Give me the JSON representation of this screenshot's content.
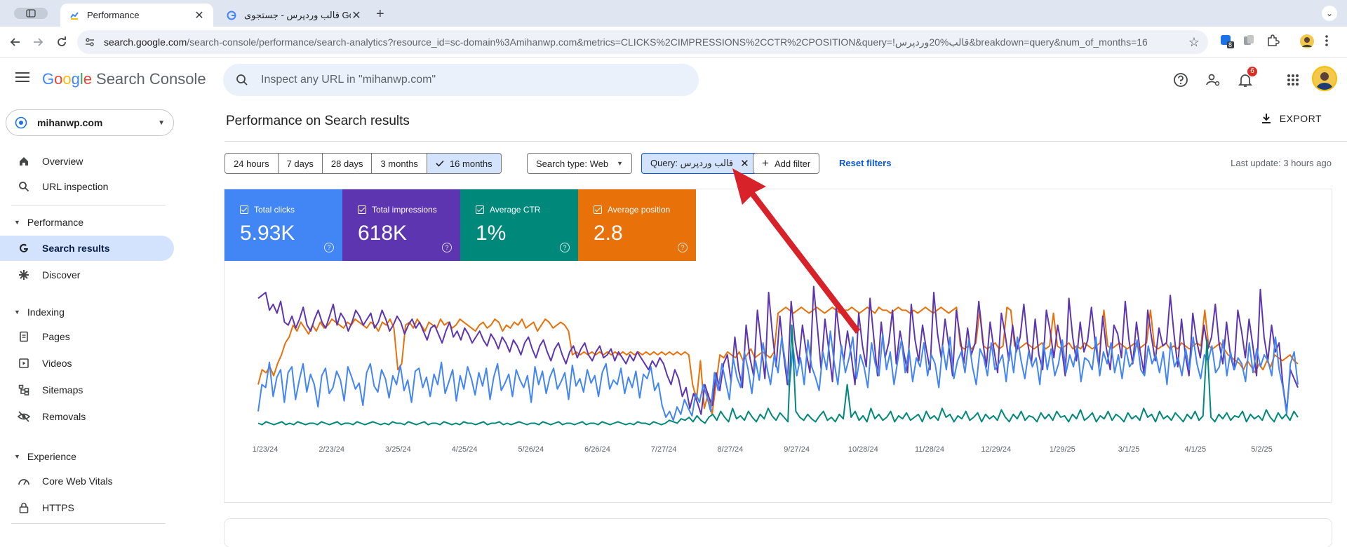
{
  "browser": {
    "tabs": [
      {
        "title": "Performance"
      },
      {
        "title": "قالب وردپرس - جستجوی Google"
      }
    ],
    "url_main": "search.google.com",
    "url_rest": "/search-console/performance/search-analytics?resource_id=sc-domain%3Amihanwp.com&metrics=CLICKS%2CIMPRESSIONS%2CCTR%2CPOSITION&query=!قالب%20وردپرس&breakdown=query&num_of_months=16",
    "ext_badge": "8"
  },
  "header": {
    "logo_letters": [
      "G",
      "o",
      "o",
      "g",
      "l",
      "e"
    ],
    "product": "Search Console",
    "search_placeholder": "Inspect any URL in \"mihanwp.com\"",
    "notifications_count": "6"
  },
  "sidebar": {
    "property": "mihanwp.com",
    "items": [
      {
        "label": "Overview",
        "icon": "home-icon"
      },
      {
        "label": "URL inspection",
        "icon": "search-icon"
      }
    ],
    "performance": {
      "section": "Performance",
      "items": [
        {
          "label": "Search results",
          "icon": "google-g-icon"
        },
        {
          "label": "Discover",
          "icon": "asterisk-icon"
        }
      ]
    },
    "indexing": {
      "section": "Indexing",
      "items": [
        {
          "label": "Pages",
          "icon": "pages-icon"
        },
        {
          "label": "Videos",
          "icon": "videos-icon"
        },
        {
          "label": "Sitemaps",
          "icon": "sitemaps-icon"
        },
        {
          "label": "Removals",
          "icon": "removals-icon"
        }
      ]
    },
    "experience": {
      "section": "Experience",
      "items": [
        {
          "label": "Core Web Vitals",
          "icon": "core-web-vitals-icon"
        },
        {
          "label": "HTTPS",
          "icon": "lock-icon"
        }
      ]
    }
  },
  "main": {
    "title": "Performance on Search results",
    "export_label": "EXPORT",
    "date_ranges": [
      "24 hours",
      "7 days",
      "28 days",
      "3 months",
      "16 months"
    ],
    "selected_range": "16 months",
    "search_type": "Search type: Web",
    "query_filter": "Query: قالب وردپرس",
    "add_filter": "Add filter",
    "reset_filters": "Reset filters",
    "last_update": "Last update: 3 hours ago"
  },
  "metrics": [
    {
      "label": "Total clicks",
      "value": "5.93K",
      "color": "#4285f4"
    },
    {
      "label": "Total impressions",
      "value": "618K",
      "color": "#5e35b1"
    },
    {
      "label": "Average CTR",
      "value": "1%",
      "color": "#00897b"
    },
    {
      "label": "Average position",
      "value": "2.8",
      "color": "#e8710a"
    }
  ],
  "chart_data": {
    "type": "line",
    "x_tick_labels": [
      "1/23/24",
      "2/23/24",
      "3/25/24",
      "4/25/24",
      "5/26/24",
      "6/26/24",
      "7/27/24",
      "8/27/24",
      "9/27/24",
      "10/28/24",
      "11/28/24",
      "12/29/24",
      "1/29/25",
      "3/1/25",
      "4/1/25",
      "5/2/25"
    ],
    "grid": false,
    "series": [
      {
        "name": "Total clicks",
        "color": "#4285f4",
        "values": [
          12,
          30,
          28,
          45,
          22,
          35,
          40,
          18,
          38,
          42,
          20,
          33,
          44,
          25,
          37,
          30,
          15,
          36,
          41,
          24,
          28,
          39,
          33,
          19,
          42,
          35,
          27,
          31,
          16,
          38,
          44,
          29,
          25,
          40,
          34,
          21,
          36,
          30,
          43,
          26,
          33,
          18,
          39,
          41,
          28,
          35,
          22,
          37,
          30,
          45,
          24,
          32,
          40,
          19,
          36,
          27,
          42,
          34,
          23,
          38,
          29,
          41,
          20,
          35,
          44,
          26,
          31,
          37,
          22,
          40,
          33,
          28,
          36,
          18,
          42,
          30,
          39,
          24,
          35,
          41,
          27,
          32,
          38,
          20,
          43,
          29,
          34,
          25,
          40,
          31,
          36,
          22,
          38,
          44,
          27,
          33,
          30,
          41,
          24,
          35,
          28,
          39,
          21,
          37,
          34,
          42,
          26,
          31,
          16,
          8,
          12,
          6,
          15,
          10,
          20,
          14,
          9,
          24,
          18,
          30,
          22,
          12,
          38,
          26,
          44,
          32,
          20,
          48,
          35,
          28,
          52,
          40,
          24,
          46,
          33,
          58,
          42,
          30,
          50,
          38,
          62,
          44,
          28,
          55,
          36,
          48,
          30,
          60,
          42,
          35,
          26,
          52,
          40,
          66,
          45,
          30,
          56,
          38,
          48,
          62,
          34,
          50,
          42,
          28,
          58,
          44,
          36,
          64,
          40,
          52,
          30,
          46,
          60,
          38,
          54,
          32,
          48,
          42,
          58,
          36,
          50,
          44,
          28,
          56,
          40,
          62,
          34,
          46,
          52,
          38,
          60,
          42,
          30,
          54,
          48,
          36,
          58,
          40,
          44,
          50,
          32,
          56,
          38,
          62,
          46,
          34,
          52,
          42,
          48,
          30,
          58,
          40,
          54,
          36,
          44,
          60,
          38,
          50,
          42,
          56,
          32,
          48,
          46,
          40,
          62,
          36,
          52,
          44,
          58,
          38,
          50,
          34,
          54,
          42,
          46,
          60,
          40,
          36,
          56,
          44,
          50,
          38,
          52,
          30,
          58,
          42,
          48,
          36,
          54,
          40,
          62,
          44,
          34,
          50,
          46,
          56,
          38,
          42,
          60,
          36,
          52,
          40,
          48,
          44,
          32,
          58,
          38,
          54,
          42,
          50,
          46,
          36,
          62,
          40,
          28,
          10,
          44,
          52,
          30
        ]
      },
      {
        "name": "Total impressions",
        "color": "#5e35b1",
        "values": [
          88,
          90,
          92,
          80,
          84,
          78,
          86,
          72,
          70,
          76,
          68,
          74,
          82,
          70,
          66,
          74,
          80,
          72,
          68,
          76,
          84,
          70,
          78,
          74,
          66,
          72,
          80,
          76,
          70,
          74,
          78,
          68,
          72,
          80,
          74,
          66,
          70,
          76,
          72,
          64,
          70,
          74,
          68,
          72,
          66,
          60,
          68,
          70,
          64,
          58,
          66,
          72,
          62,
          66,
          60,
          68,
          64,
          58,
          62,
          66,
          60,
          56,
          64,
          60,
          54,
          62,
          58,
          52,
          60,
          56,
          50,
          58,
          62,
          54,
          48,
          56,
          60,
          52,
          46,
          54,
          58,
          50,
          44,
          52,
          56,
          48,
          54,
          58,
          50,
          46,
          52,
          56,
          48,
          50,
          54,
          46,
          52,
          48,
          44,
          50,
          46,
          52,
          48,
          44,
          40,
          46,
          42,
          48,
          44,
          36,
          30,
          40,
          34,
          22,
          28,
          14,
          24,
          18,
          10,
          30,
          22,
          16,
          38,
          26,
          44,
          50,
          32,
          62,
          40,
          28,
          70,
          48,
          36,
          80,
          58,
          34,
          92,
          64,
          42,
          76,
          50,
          30,
          86,
          60,
          44,
          70,
          52,
          38,
          96,
          68,
          40,
          74,
          54,
          32,
          82,
          60,
          46,
          66,
          50,
          30,
          78,
          56,
          42,
          88,
          62,
          36,
          72,
          48,
          58,
          80,
          44,
          66,
          52,
          38,
          84,
          60,
          46,
          70,
          54,
          40,
          92,
          64,
          48,
          74,
          56,
          36,
          80,
          62,
          44,
          68,
          50,
          58,
          86,
          60,
          42,
          72,
          54,
          38,
          78,
          64,
          46,
          70,
          52,
          62,
          84,
          58,
          44,
          74,
          50,
          40,
          80,
          66,
          48,
          70,
          56,
          36,
          88,
          62,
          46,
          72,
          52,
          60,
          82,
          58,
          42,
          76,
          54,
          40,
          70,
          64,
          48,
          86,
          60,
          44,
          72,
          52,
          38,
          80,
          62,
          46,
          68,
          56,
          58,
          90,
          64,
          42,
          74,
          50,
          36,
          78,
          60,
          48,
          70,
          54,
          62,
          84,
          58,
          44,
          72,
          50,
          40,
          80,
          66,
          48,
          74,
          56,
          36,
          94,
          62,
          46,
          70,
          52,
          58,
          30,
          12,
          40,
          34,
          28
        ]
      },
      {
        "name": "Average CTR",
        "color": "#00897b",
        "values": [
          4,
          3,
          5,
          4,
          3,
          4,
          5,
          3,
          4,
          3,
          5,
          4,
          3,
          4,
          4,
          3,
          5,
          4,
          3,
          4,
          5,
          3,
          4,
          4,
          3,
          5,
          4,
          3,
          4,
          5,
          4,
          3,
          4,
          3,
          5,
          4,
          4,
          3,
          5,
          4,
          3,
          4,
          5,
          3,
          4,
          4,
          3,
          5,
          4,
          3,
          4,
          3,
          5,
          4,
          4,
          3,
          4,
          5,
          3,
          4,
          4,
          5,
          3,
          4,
          3,
          4,
          5,
          4,
          3,
          4,
          4,
          3,
          5,
          4,
          3,
          4,
          5,
          3,
          4,
          4,
          3,
          4,
          5,
          3,
          4,
          4,
          3,
          5,
          4,
          3,
          4,
          5,
          4,
          3,
          4,
          3,
          5,
          4,
          4,
          3,
          5,
          4,
          3,
          4,
          6,
          5,
          4,
          7,
          6,
          8,
          5,
          9,
          6,
          4,
          8,
          10,
          6,
          12,
          8,
          5,
          14,
          7,
          9,
          6,
          12,
          8,
          5,
          10,
          7,
          14,
          9,
          6,
          11,
          8,
          5,
          70,
          12,
          8,
          6,
          10,
          7,
          5,
          9,
          12,
          6,
          8,
          5,
          10,
          7,
          30,
          8,
          12,
          6,
          9,
          5,
          14,
          7,
          10,
          6,
          8,
          12,
          5,
          9,
          7,
          11,
          6,
          8,
          10,
          5,
          12,
          7,
          9,
          6,
          14,
          8,
          10,
          5,
          9,
          7,
          12,
          6,
          8,
          11,
          5,
          10,
          7,
          9,
          6,
          13,
          8,
          5,
          10,
          7,
          12,
          6,
          9,
          8,
          5,
          11,
          7,
          10,
          6,
          12,
          8,
          9,
          5,
          10,
          7,
          13,
          6,
          8,
          11,
          5,
          9,
          7,
          12,
          6,
          10,
          8,
          5,
          11,
          7,
          9,
          6,
          14,
          8,
          10,
          5,
          12,
          7,
          9,
          6,
          11,
          8,
          5,
          10,
          7,
          12,
          6,
          9,
          60,
          8,
          5,
          10,
          7,
          11,
          6,
          9,
          8,
          12,
          5,
          10,
          7,
          9,
          6,
          13,
          8,
          5,
          11,
          7,
          10,
          6,
          12,
          8
        ]
      },
      {
        "name": "Average position",
        "color": "#e8710a",
        "values": [
          30,
          40,
          38,
          42,
          36,
          44,
          50,
          58,
          62,
          70,
          66,
          72,
          68,
          64,
          70,
          66,
          72,
          68,
          70,
          74,
          72,
          70,
          68,
          72,
          70,
          74,
          72,
          70,
          68,
          72,
          70,
          66,
          72,
          70,
          74,
          68,
          40,
          44,
          70,
          72,
          68,
          74,
          70,
          66,
          72,
          70,
          68,
          74,
          70,
          72,
          68,
          70,
          74,
          72,
          70,
          68,
          66,
          70,
          72,
          68,
          70,
          74,
          72,
          66,
          70,
          68,
          72,
          70,
          74,
          68,
          70,
          72,
          66,
          70,
          74,
          72,
          68,
          70,
          72,
          70,
          66,
          50,
          52,
          50,
          52,
          50,
          52,
          50,
          52,
          50,
          52,
          50,
          52,
          50,
          52,
          50,
          52,
          50,
          52,
          50,
          52,
          50,
          52,
          50,
          52,
          50,
          52,
          50,
          52,
          50,
          52,
          50,
          30,
          20,
          46,
          14,
          24,
          10,
          30,
          50,
          48,
          52,
          50,
          48,
          52,
          46,
          50,
          54,
          48,
          50,
          52,
          50,
          48,
          52,
          78,
          80,
          82,
          80,
          78,
          80,
          82,
          80,
          78,
          80,
          82,
          80,
          78,
          80,
          82,
          80,
          78,
          80,
          80,
          82,
          80,
          78,
          80,
          82,
          80,
          78,
          82,
          80,
          80,
          78,
          80,
          82,
          80,
          80,
          78,
          80,
          78,
          80,
          82,
          80,
          78,
          80,
          82,
          80,
          78,
          80,
          82,
          56,
          54,
          56,
          54,
          58,
          80,
          56,
          54,
          56,
          58,
          54,
          56,
          82,
          80,
          56,
          54,
          56,
          58,
          56,
          54,
          56,
          58,
          54,
          56,
          78,
          56,
          54,
          56,
          58,
          54,
          56,
          54,
          58,
          56,
          54,
          56,
          58,
          80,
          56,
          54,
          56,
          58,
          56,
          54,
          56,
          58,
          54,
          56,
          58,
          80,
          56,
          54,
          56,
          58,
          54,
          56,
          54,
          58,
          56,
          54,
          56,
          58,
          56,
          80,
          56,
          54,
          56,
          58,
          54,
          50,
          48,
          46,
          44,
          40,
          46,
          42,
          38,
          44,
          40,
          46,
          42,
          50,
          48,
          46,
          48,
          50,
          46,
          44
        ]
      }
    ]
  }
}
